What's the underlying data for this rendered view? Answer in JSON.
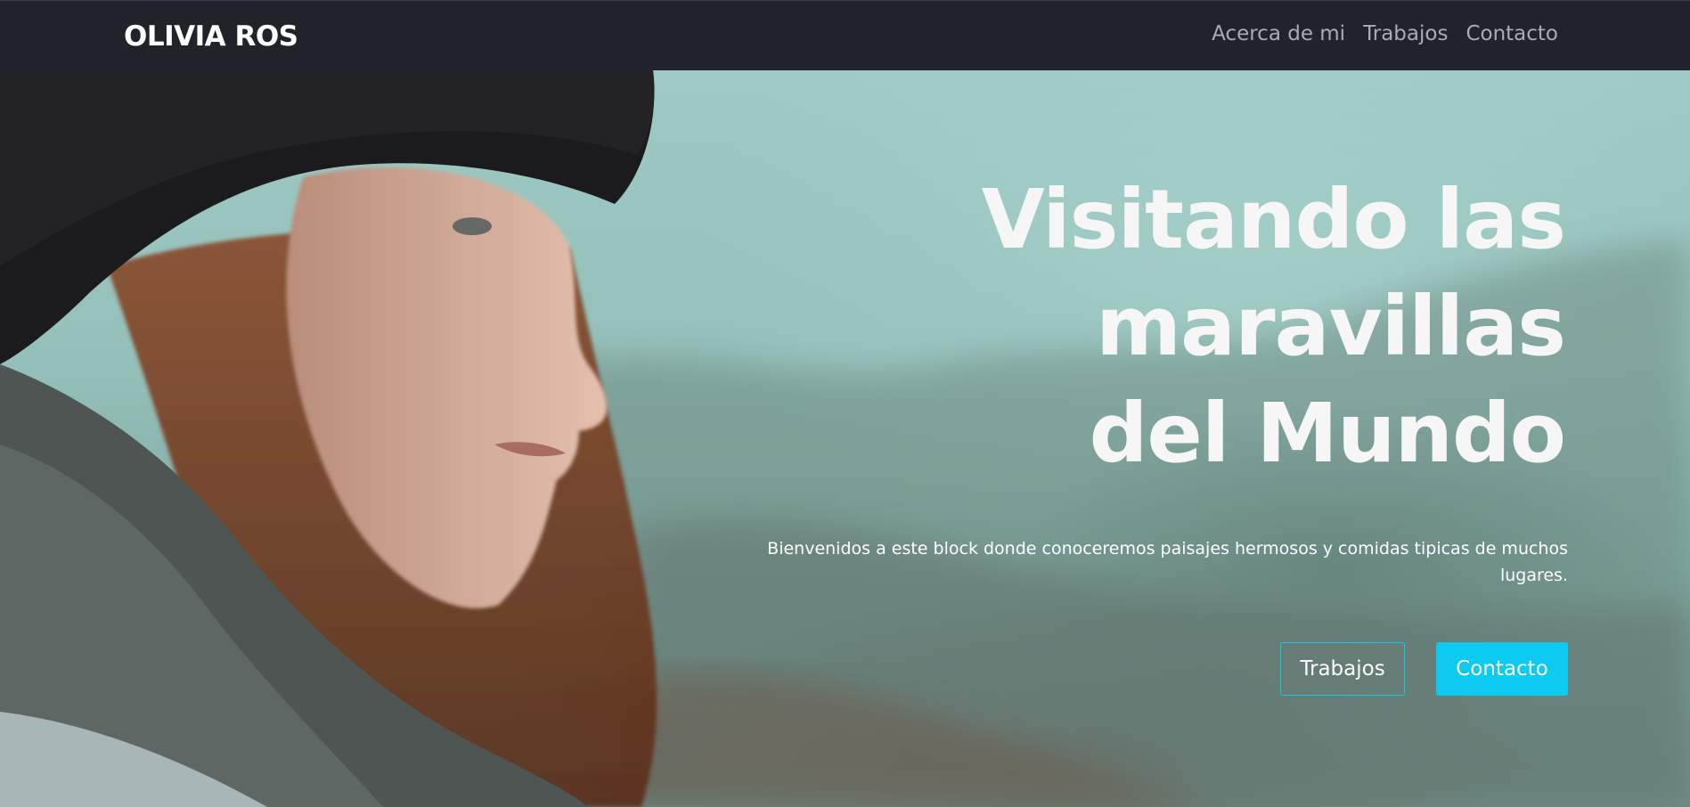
{
  "navbar": {
    "brand": "OLIVIA ROS",
    "links": [
      "Acerca de mi",
      "Trabajos",
      "Contacto"
    ]
  },
  "hero": {
    "title_lines": [
      "Visitando las",
      "maravillas",
      "del Mundo"
    ],
    "subtitle": "Bienvenidos a este block donde conoceremos paisajes hermosos y comidas tipicas de muchos lugares.",
    "buttons": {
      "outline_label": "Trabajos",
      "solid_label": "Contacto"
    },
    "background_image": "woman-in-beanie-landscape-photo"
  },
  "colors": {
    "navbar_bg": "#202329",
    "nav_link": "#a9adb3",
    "accent": "#0dcaf0",
    "text_light": "#ffffff"
  }
}
